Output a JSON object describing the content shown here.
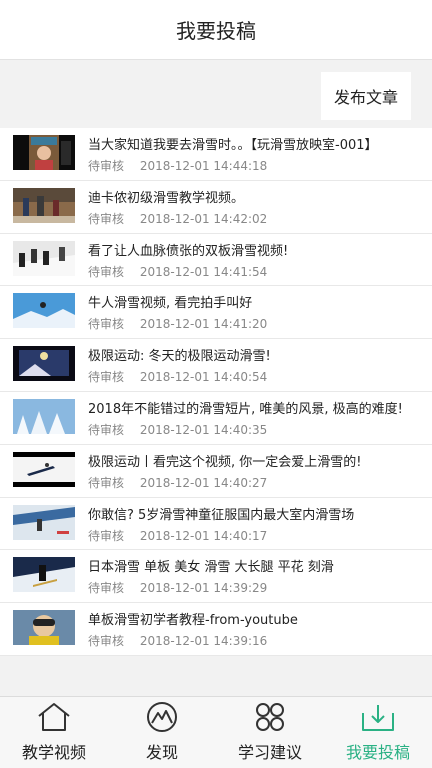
{
  "header": {
    "title": "我要投稿"
  },
  "toolbar": {
    "publish_label": "发布文章"
  },
  "posts": [
    {
      "title": "当大家知道我要去滑雪时。。【玩滑雪放映室-001】",
      "status": "待审核",
      "time": "2018-12-01 14:44:18",
      "thumb_icon": "portrait-thumb"
    },
    {
      "title": "迪卡侬初级滑雪教学视频。",
      "status": "待审核",
      "time": "2018-12-01 14:42:02",
      "thumb_icon": "indoor-thumb"
    },
    {
      "title": "看了让人血脉偾张的双板滑雪视频!",
      "status": "待审核",
      "time": "2018-12-01 14:41:54",
      "thumb_icon": "skiers-thumb"
    },
    {
      "title": "牛人滑雪视频, 看完拍手叫好",
      "status": "待审核",
      "time": "2018-12-01 14:41:20",
      "thumb_icon": "mountain-thumb"
    },
    {
      "title": "极限运动: 冬天的极限运动滑雪!",
      "status": "待审核",
      "time": "2018-12-01 14:40:54",
      "thumb_icon": "night-thumb"
    },
    {
      "title": "2018年不能错过的滑雪短片, 唯美的风景, 极高的难度!",
      "status": "待审核",
      "time": "2018-12-01 14:40:35",
      "thumb_icon": "snowy-trees-thumb"
    },
    {
      "title": "极限运动丨看完这个视频, 你一定会爱上滑雪的!",
      "status": "待审核",
      "time": "2018-12-01 14:40:27",
      "thumb_icon": "jump-thumb"
    },
    {
      "title": "你敢信? 5岁滑雪神童征服国内最大室内滑雪场",
      "status": "待审核",
      "time": "2018-12-01 14:40:17",
      "thumb_icon": "indoor-slope-thumb"
    },
    {
      "title": "日本滑雪 单板 美女 滑雪 大长腿 平花 刻滑",
      "status": "待审核",
      "time": "2018-12-01 14:39:29",
      "thumb_icon": "snowboarder-thumb"
    },
    {
      "title": "单板滑雪初学者教程-from-youtube",
      "status": "待审核",
      "time": "2018-12-01 14:39:16",
      "thumb_icon": "goggles-thumb"
    }
  ],
  "tabs": [
    {
      "label": "教学视频",
      "icon": "home-icon",
      "active": false
    },
    {
      "label": "发现",
      "icon": "compass-icon",
      "active": false
    },
    {
      "label": "学习建议",
      "icon": "grid-icon",
      "active": false
    },
    {
      "label": "我要投稿",
      "icon": "upload-icon",
      "active": true
    }
  ],
  "colors": {
    "accent": "#2ab184",
    "icon_default": "#333333"
  }
}
